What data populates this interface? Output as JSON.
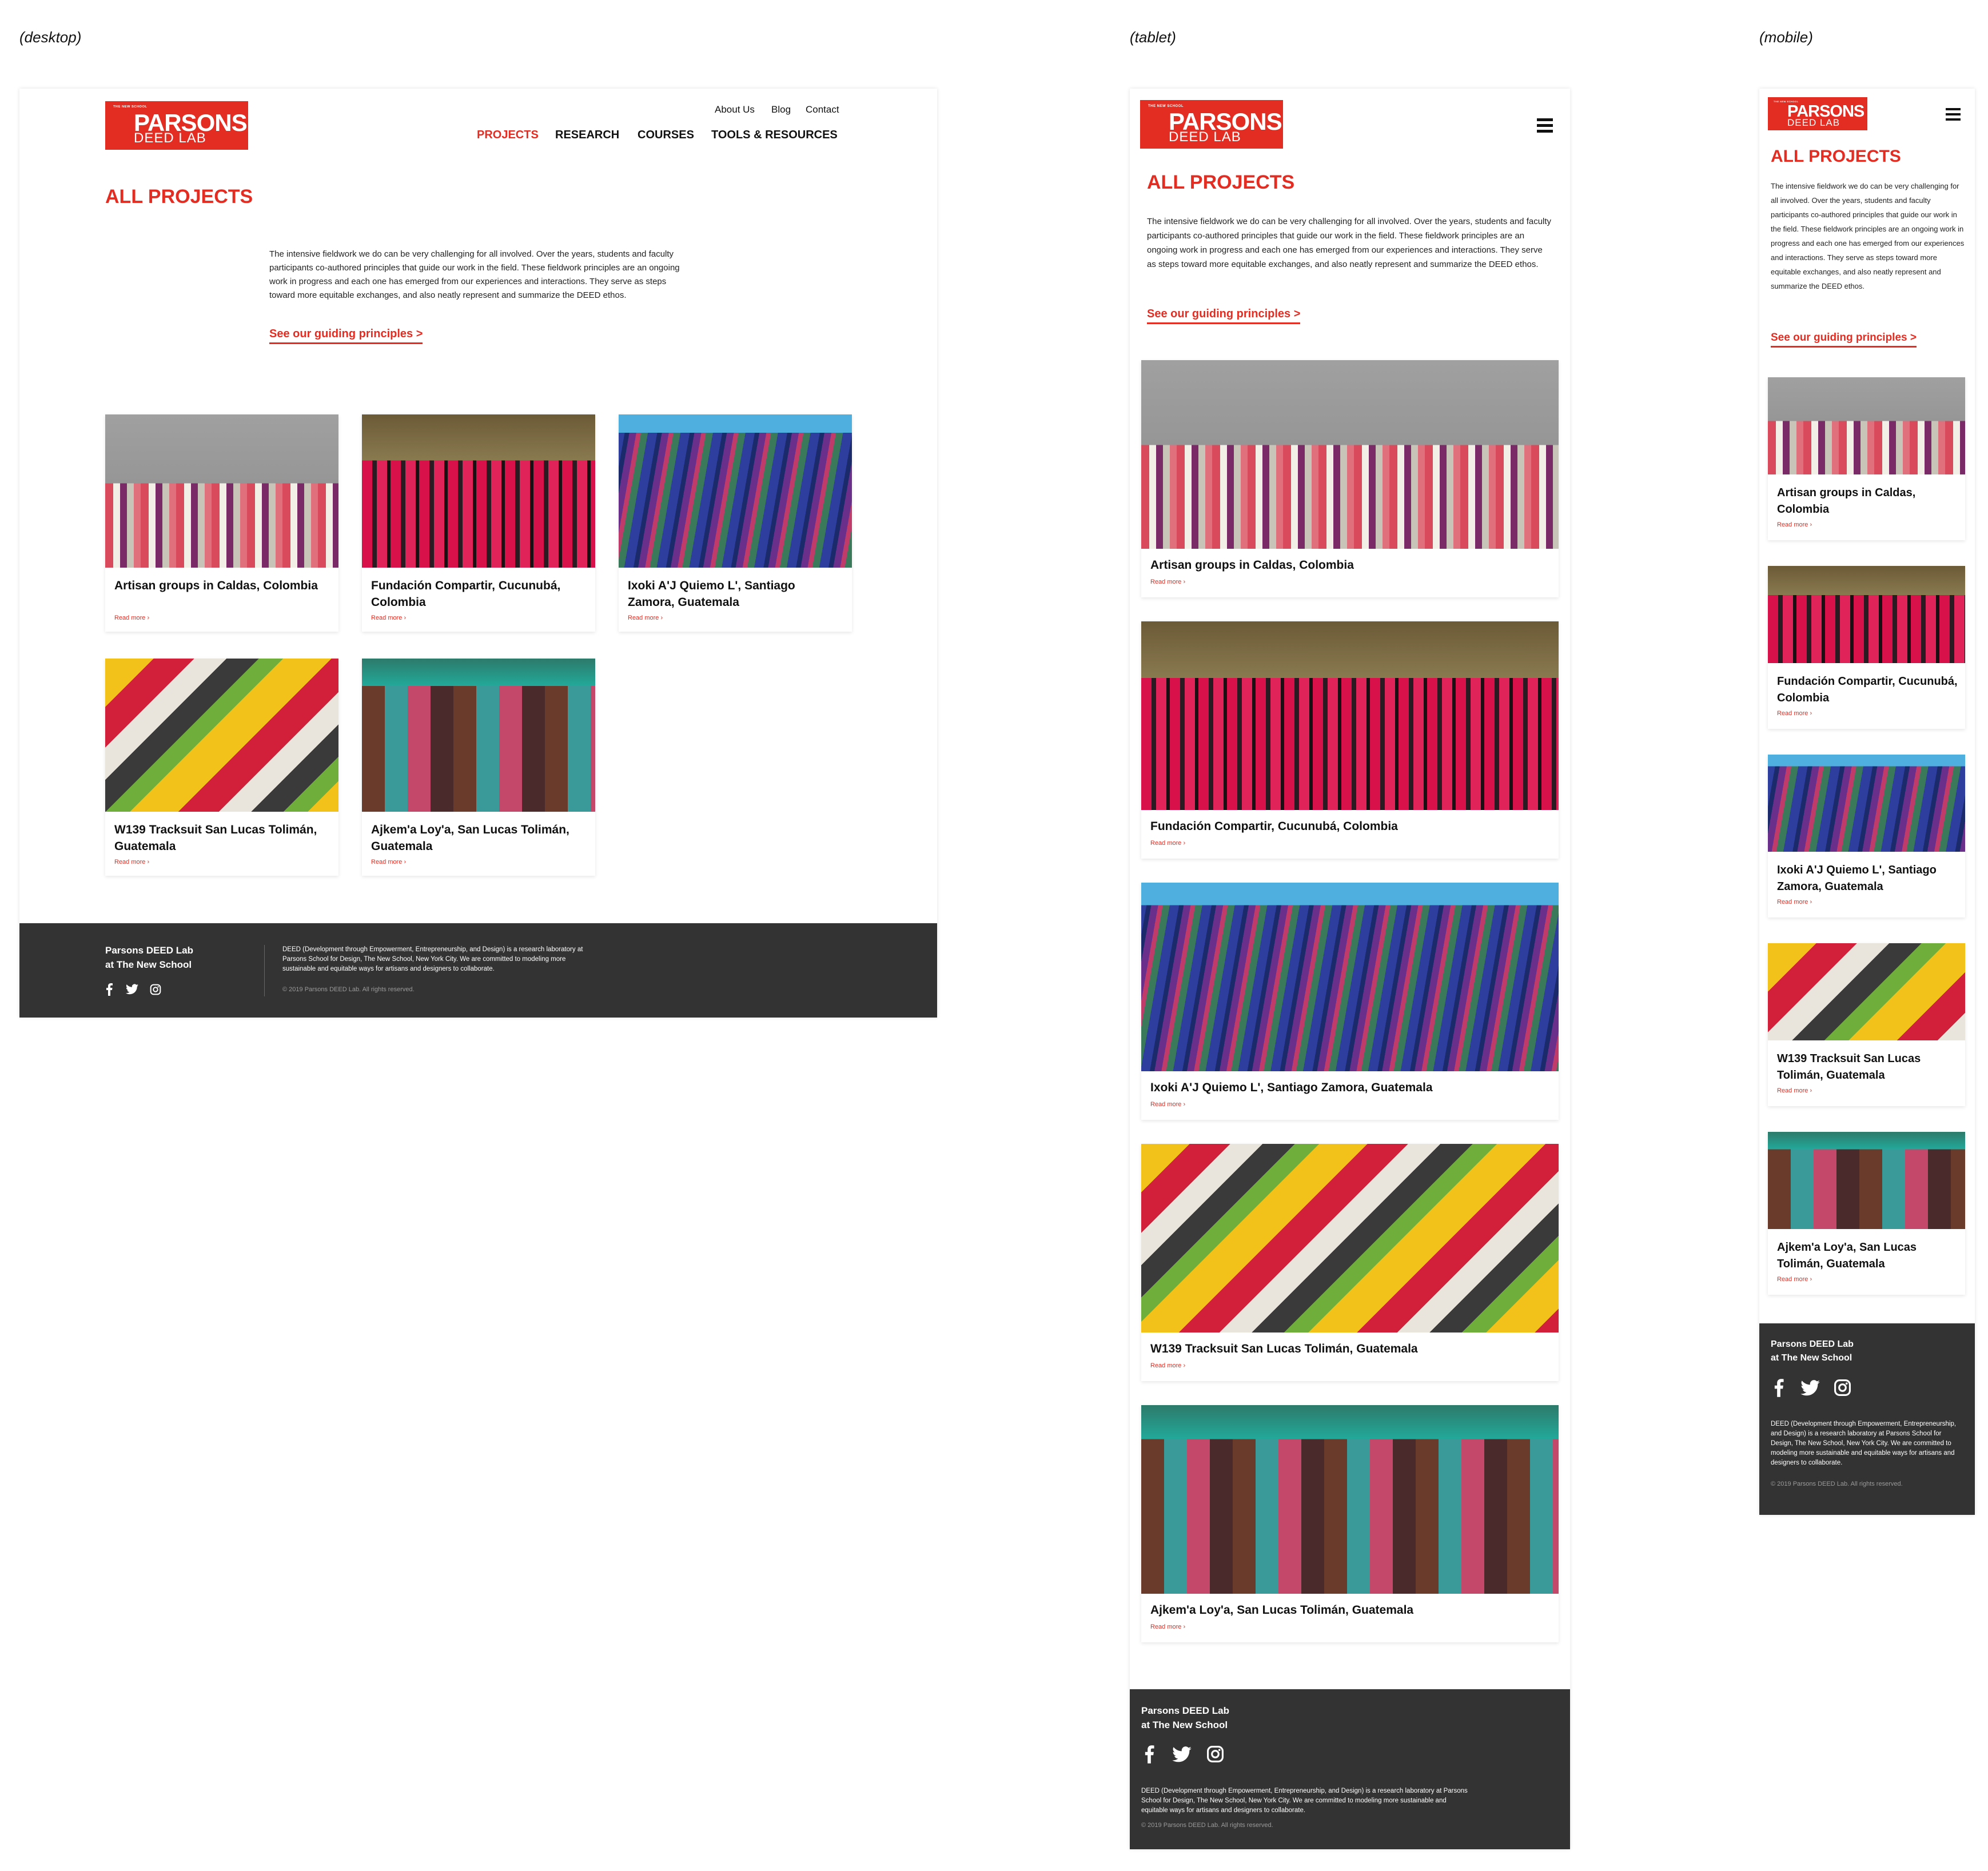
{
  "viewport_labels": {
    "desktop": "(desktop)",
    "tablet": "(tablet)",
    "mobile": "(mobile)"
  },
  "logo": {
    "small": "THE NEW SCHOOL",
    "big": "PARSONS",
    "sub": "DEED LAB"
  },
  "utility_nav": [
    "About Us",
    "Blog",
    "Contact"
  ],
  "main_nav": [
    "PROJECTS",
    "RESEARCH",
    "COURSES",
    "TOOLS & RESOURCES"
  ],
  "page_title": "ALL PROJECTS",
  "intro": "The intensive fieldwork we do can be very challenging for all involved. Over the years, students and faculty participants co-authored principles that guide our work in the field. These fieldwork principles are an ongoing work in progress and each one has emerged from our experiences and interactions. They serve as steps toward more equitable exchanges, and also neatly represent and summarize the DEED ethos.",
  "principles_link": "See our guiding principles >",
  "read_more": "Read more ›",
  "projects": [
    {
      "title": "Artisan groups in Caldas, Colombia"
    },
    {
      "title": "Fundación Compartir, Cucunubá, Colombia"
    },
    {
      "title": "Ixoki A'J Quiemo L', Santiago Zamora, Guatemala"
    },
    {
      "title": "W139 Tracksuit San Lucas Tolimán, Guatemala"
    },
    {
      "title": "Ajkem'a Loy'a, San Lucas Tolimán, Guatemala"
    }
  ],
  "footer": {
    "org_line1": "Parsons DEED Lab",
    "org_line2": "at The New School",
    "description": "DEED (Development through Empowerment, Entrepreneurship, and Design) is a research laboratory at Parsons School for Design, The New School, New York City. We are committed to modeling more sustainable and equitable ways for artisans and designers to collaborate.",
    "copyright": "© 2019 Parsons DEED Lab. All rights reserved.",
    "social": [
      "facebook-icon",
      "twitter-icon",
      "instagram-icon"
    ]
  },
  "colors": {
    "accent": "#e32d22",
    "footer_bg": "#333333"
  }
}
